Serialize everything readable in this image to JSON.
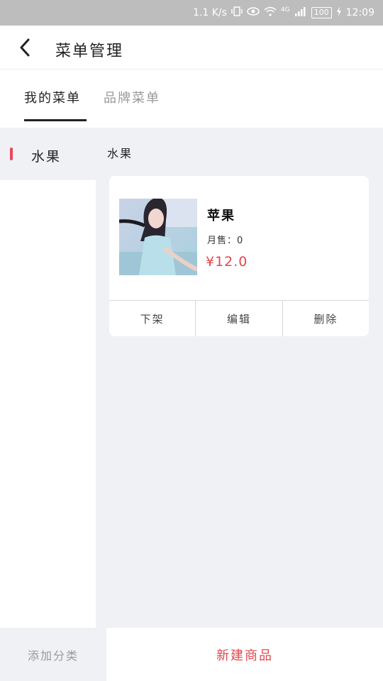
{
  "status_bar": {
    "speed": "1.1 K/s",
    "network": "4G",
    "battery": "100",
    "time": "12:09"
  },
  "header": {
    "title": "菜单管理",
    "back_icon": "chevron-left-icon"
  },
  "tabs": [
    {
      "label": "我的菜单",
      "active": true
    },
    {
      "label": "品牌菜单",
      "active": false
    }
  ],
  "sidebar": {
    "categories": [
      {
        "label": "水果",
        "active": true
      }
    ]
  },
  "main": {
    "section_title": "水果",
    "products": [
      {
        "name": "苹果",
        "monthly_sales": "月售：0",
        "price": "¥12.0",
        "actions": [
          "下架",
          "编辑",
          "删除"
        ]
      }
    ]
  },
  "bottom": {
    "add_category": "添加分类",
    "new_product": "新建商品"
  },
  "colors": {
    "accent_red": "#e0484d",
    "indicator": "#e8485a",
    "background": "#f0f1f5"
  }
}
